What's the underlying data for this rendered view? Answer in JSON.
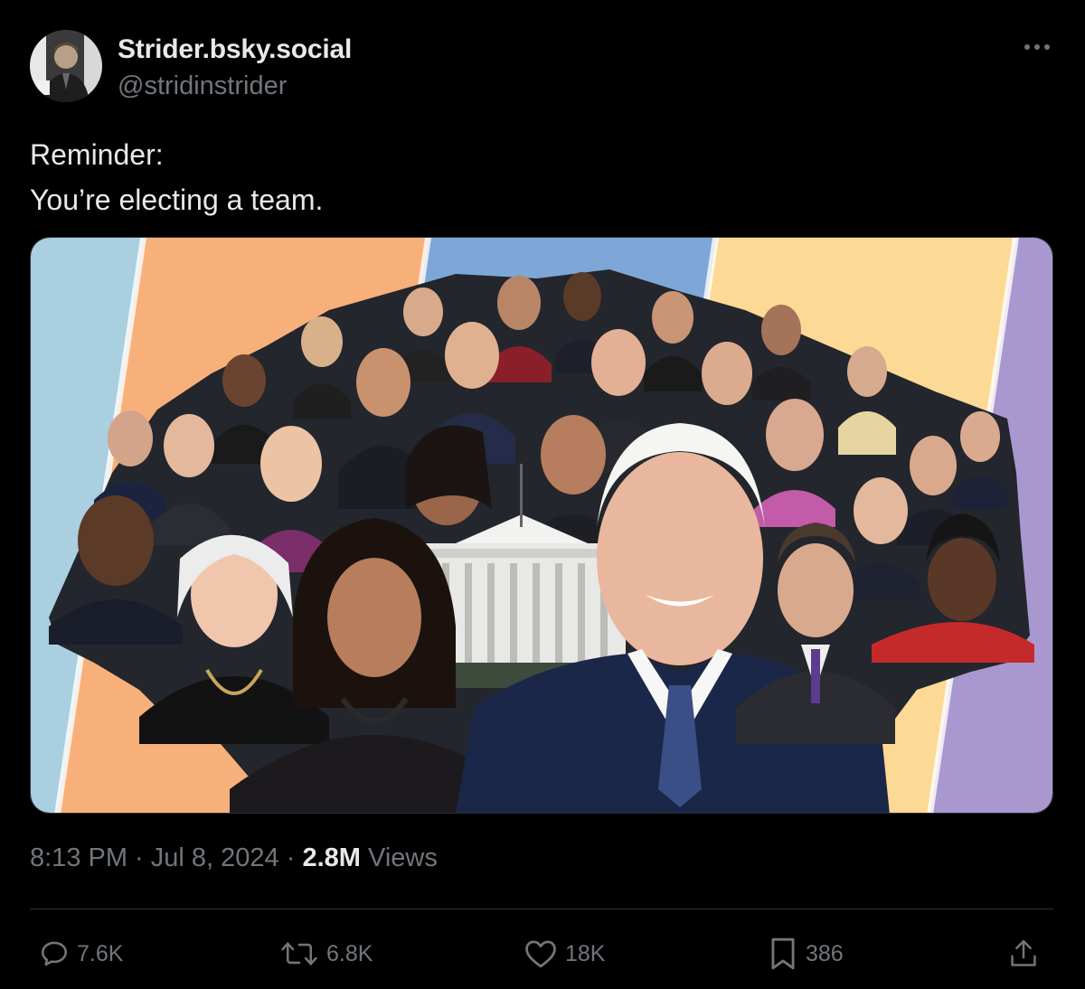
{
  "author": {
    "display_name": "Strider.bsky.social",
    "handle": "@stridinstrider",
    "avatar_icon": "profile-photo"
  },
  "more_icon": "more-horizontal-icon",
  "tweet": {
    "lines": [
      "Reminder:",
      "You’re electing a team."
    ]
  },
  "media": {
    "type": "photo-collage",
    "stripe_colors": [
      "#a9cfe0",
      "#f8b07a",
      "#7ea7d8",
      "#fdd996",
      "#a998cf"
    ]
  },
  "meta": {
    "time": "8:13 PM",
    "sep1": " · ",
    "date": "Jul 8, 2024",
    "sep2": " · ",
    "views_count": "2.8M",
    "views_label": " Views"
  },
  "actions": {
    "reply": {
      "icon": "reply-icon",
      "count": "7.6K"
    },
    "repost": {
      "icon": "repost-icon",
      "count": "6.8K"
    },
    "like": {
      "icon": "heart-icon",
      "count": "18K"
    },
    "bookmark": {
      "icon": "bookmark-icon",
      "count": "386"
    },
    "share": {
      "icon": "share-icon"
    }
  },
  "colors": {
    "background": "#000000",
    "text_primary": "#e7e9ea",
    "text_secondary": "#71767b",
    "divider": "#2f3336"
  }
}
